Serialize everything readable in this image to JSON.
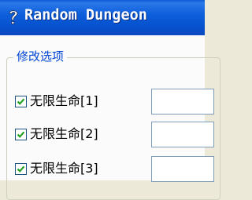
{
  "window": {
    "title": "Random Dungeon",
    "icon": "question-mark-icon"
  },
  "group": {
    "label": "修改选项",
    "options": [
      {
        "label": "无限生命[1]",
        "checked": true,
        "value": ""
      },
      {
        "label": "无限生命[2]",
        "checked": true,
        "value": ""
      },
      {
        "label": "无限生命[3]",
        "checked": true,
        "value": ""
      }
    ]
  },
  "colors": {
    "titlebar": "#0753d0",
    "group_label": "#0046d5",
    "checkmark": "#21a121",
    "panel": "#fbfbfb"
  }
}
